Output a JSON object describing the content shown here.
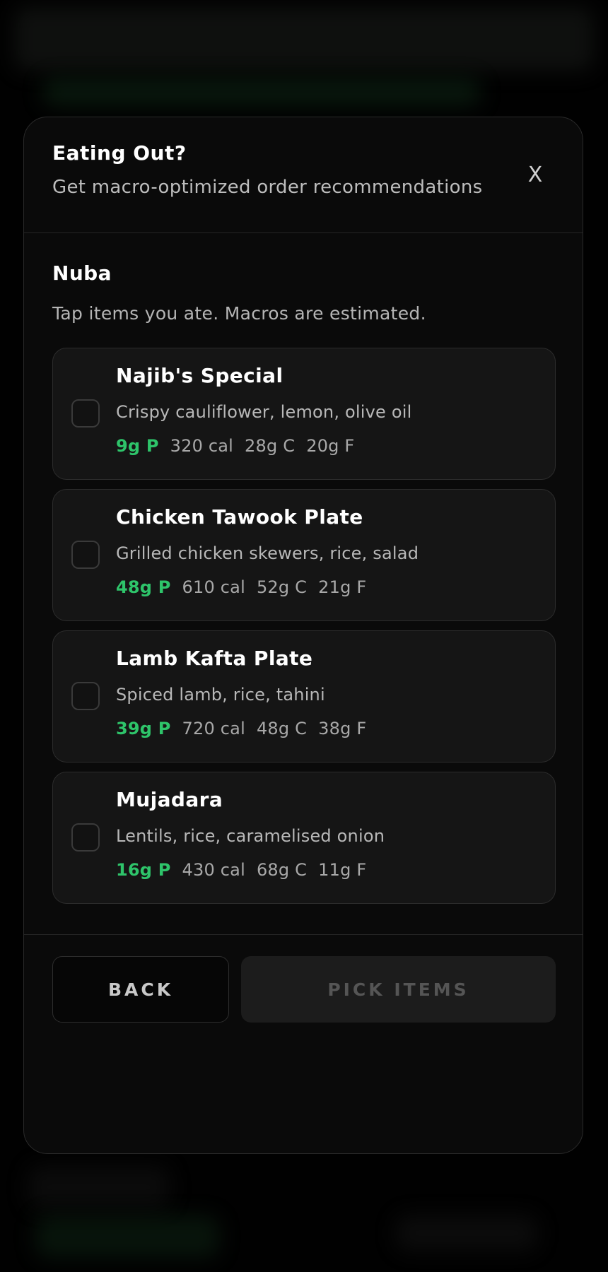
{
  "modal": {
    "title": "Eating Out?",
    "subtitle": "Get macro-optimized order recommendations",
    "close_label": "X"
  },
  "restaurant": {
    "name": "Nuba",
    "instructions": "Tap items you ate. Macros are estimated."
  },
  "items": [
    {
      "name": "Najib's Special",
      "description": "Crispy cauliflower, lemon, olive oil",
      "protein": "9g P",
      "calories": "320 cal",
      "carbs": "28g C",
      "fat": "20g F",
      "checked": false
    },
    {
      "name": "Chicken Tawook Plate",
      "description": "Grilled chicken skewers, rice, salad",
      "protein": "48g P",
      "calories": "610 cal",
      "carbs": "52g C",
      "fat": "21g F",
      "checked": false
    },
    {
      "name": "Lamb Kafta Plate",
      "description": "Spiced lamb, rice, tahini",
      "protein": "39g P",
      "calories": "720 cal",
      "carbs": "48g C",
      "fat": "38g F",
      "checked": false
    },
    {
      "name": "Mujadara",
      "description": "Lentils, rice, caramelised onion",
      "protein": "16g P",
      "calories": "430 cal",
      "carbs": "68g C",
      "fat": "11g F",
      "checked": false
    }
  ],
  "footer": {
    "back_label": "BACK",
    "pick_label": "PICK ITEMS"
  },
  "colors": {
    "protein_accent": "#2ec46a",
    "surface": "#0a0a0a",
    "card": "#151515",
    "disabled_button": "#1c1c1c"
  }
}
